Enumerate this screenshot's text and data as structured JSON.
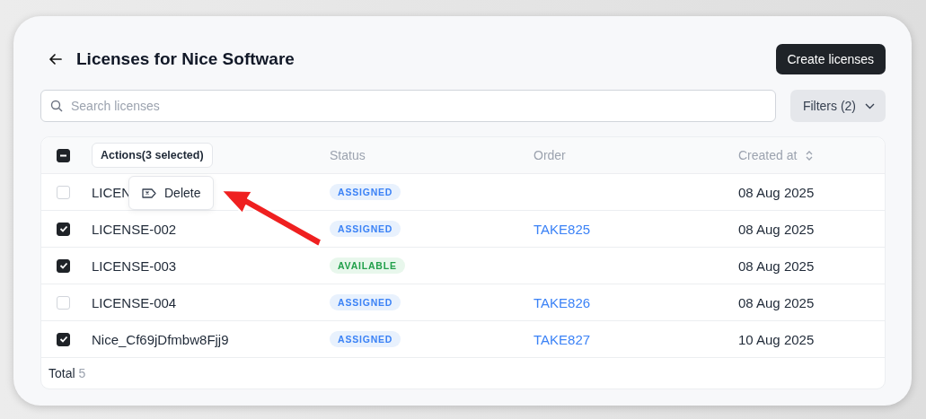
{
  "header": {
    "title": "Licenses for Nice Software",
    "create_button": "Create licenses"
  },
  "search": {
    "placeholder": "Search licenses"
  },
  "filters": {
    "label": "Filters (2)"
  },
  "table": {
    "header_checkbox": {
      "checked": true,
      "indeterminate": true
    },
    "actions_label": "Actions(3 selected)",
    "columns": [
      "Status",
      "Order",
      "Created at"
    ],
    "rows": [
      {
        "name": "LICEN",
        "checked": false,
        "status": "ASSIGNED",
        "kind": "assigned",
        "created": "08 Aug 2025"
      },
      {
        "name": "LICENSE-002",
        "checked": true,
        "status": "ASSIGNED",
        "kind": "assigned",
        "order": "TAKE825",
        "created": "08 Aug 2025"
      },
      {
        "name": "LICENSE-003",
        "checked": true,
        "status": "AVAILABLE",
        "kind": "available",
        "created": "08 Aug 2025"
      },
      {
        "name": "LICENSE-004",
        "checked": false,
        "status": "ASSIGNED",
        "kind": "assigned",
        "order": "TAKE826",
        "created": "08 Aug 2025"
      },
      {
        "name": "Nice_Cf69jDfmbw8Fjj9",
        "checked": true,
        "status": "ASSIGNED",
        "kind": "assigned",
        "order": "TAKE827",
        "created": "10 Aug 2025"
      }
    ],
    "total_label": "Total",
    "total_value": "5"
  },
  "menu": {
    "items": [
      {
        "label": "Delete"
      }
    ]
  }
}
